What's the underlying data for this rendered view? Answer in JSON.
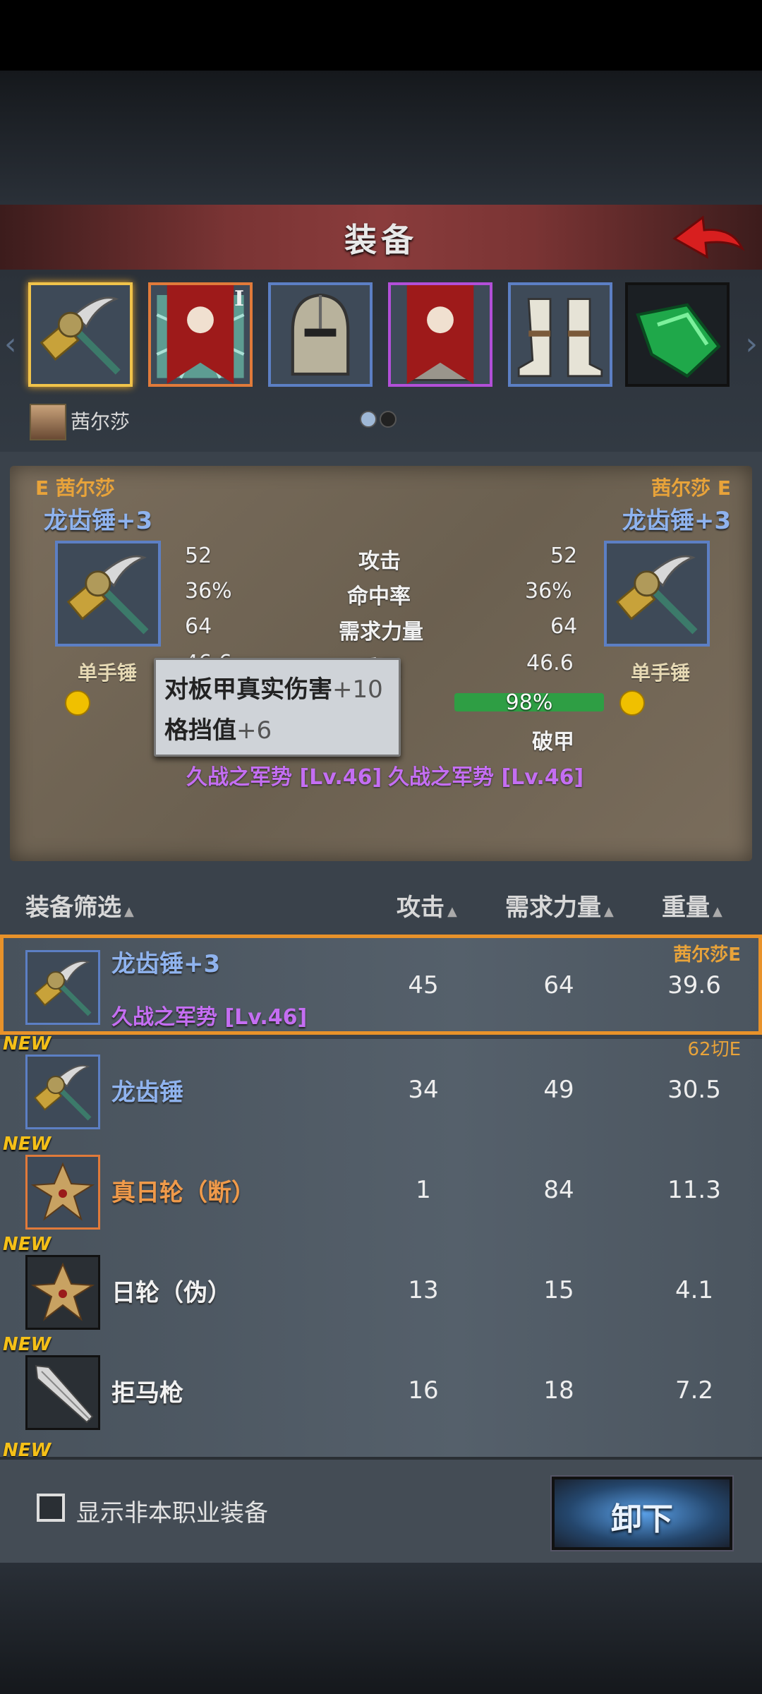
{
  "header": {
    "title": "装备"
  },
  "slots": {
    "character_name": "茜尔莎",
    "roman_numeral": "I"
  },
  "compare": {
    "left": {
      "tag": "E 茜尔莎",
      "name": "龙齿锤+3",
      "type": "单手锤"
    },
    "right": {
      "tag": "茜尔莎 E",
      "name": "龙齿锤+3",
      "type": "单手锤"
    },
    "stats": [
      {
        "label": "攻击",
        "left": "52",
        "right": "52"
      },
      {
        "label": "命中率",
        "left": "36%",
        "right": "36%"
      },
      {
        "label": "需求力量",
        "left": "64",
        "right": "64"
      },
      {
        "label": "重量",
        "left": "46.6",
        "right": "46.6"
      }
    ],
    "durability": "98%",
    "durability_fraction": 0.98,
    "trait": "破甲",
    "skill_left": "久战之军势 [Lv.46]",
    "skill_right": "久战之军势 [Lv.46]",
    "tooltip": {
      "line1_name": "对板甲真实伤害",
      "line1_val": "+10",
      "line2_name": "格挡值",
      "line2_val": "+6"
    }
  },
  "list_header": {
    "filter": "装备筛选",
    "atk": "攻击",
    "str": "需求力量",
    "weight": "重量"
  },
  "items": [
    {
      "name": "龙齿锤+3",
      "skill": "久战之军势 [Lv.46]",
      "owner": "茜尔莎E",
      "atk": "45",
      "str": "64",
      "weight": "39.6"
    },
    {
      "new": "NEW",
      "name": "龙齿锤",
      "owner": "62切E",
      "atk": "34",
      "str": "49",
      "weight": "30.5"
    },
    {
      "new": "NEW",
      "name": "真日轮（断）",
      "atk": "1",
      "str": "84",
      "weight": "11.3"
    },
    {
      "new": "NEW",
      "name": "日轮（伪）",
      "atk": "13",
      "str": "15",
      "weight": "4.1"
    },
    {
      "new": "NEW",
      "name": "拒马枪",
      "atk": "16",
      "str": "18",
      "weight": "7.2"
    },
    {
      "new": "NEW"
    }
  ],
  "footer": {
    "checkbox_label": "显示非本职业装备",
    "unequip": "卸下"
  }
}
